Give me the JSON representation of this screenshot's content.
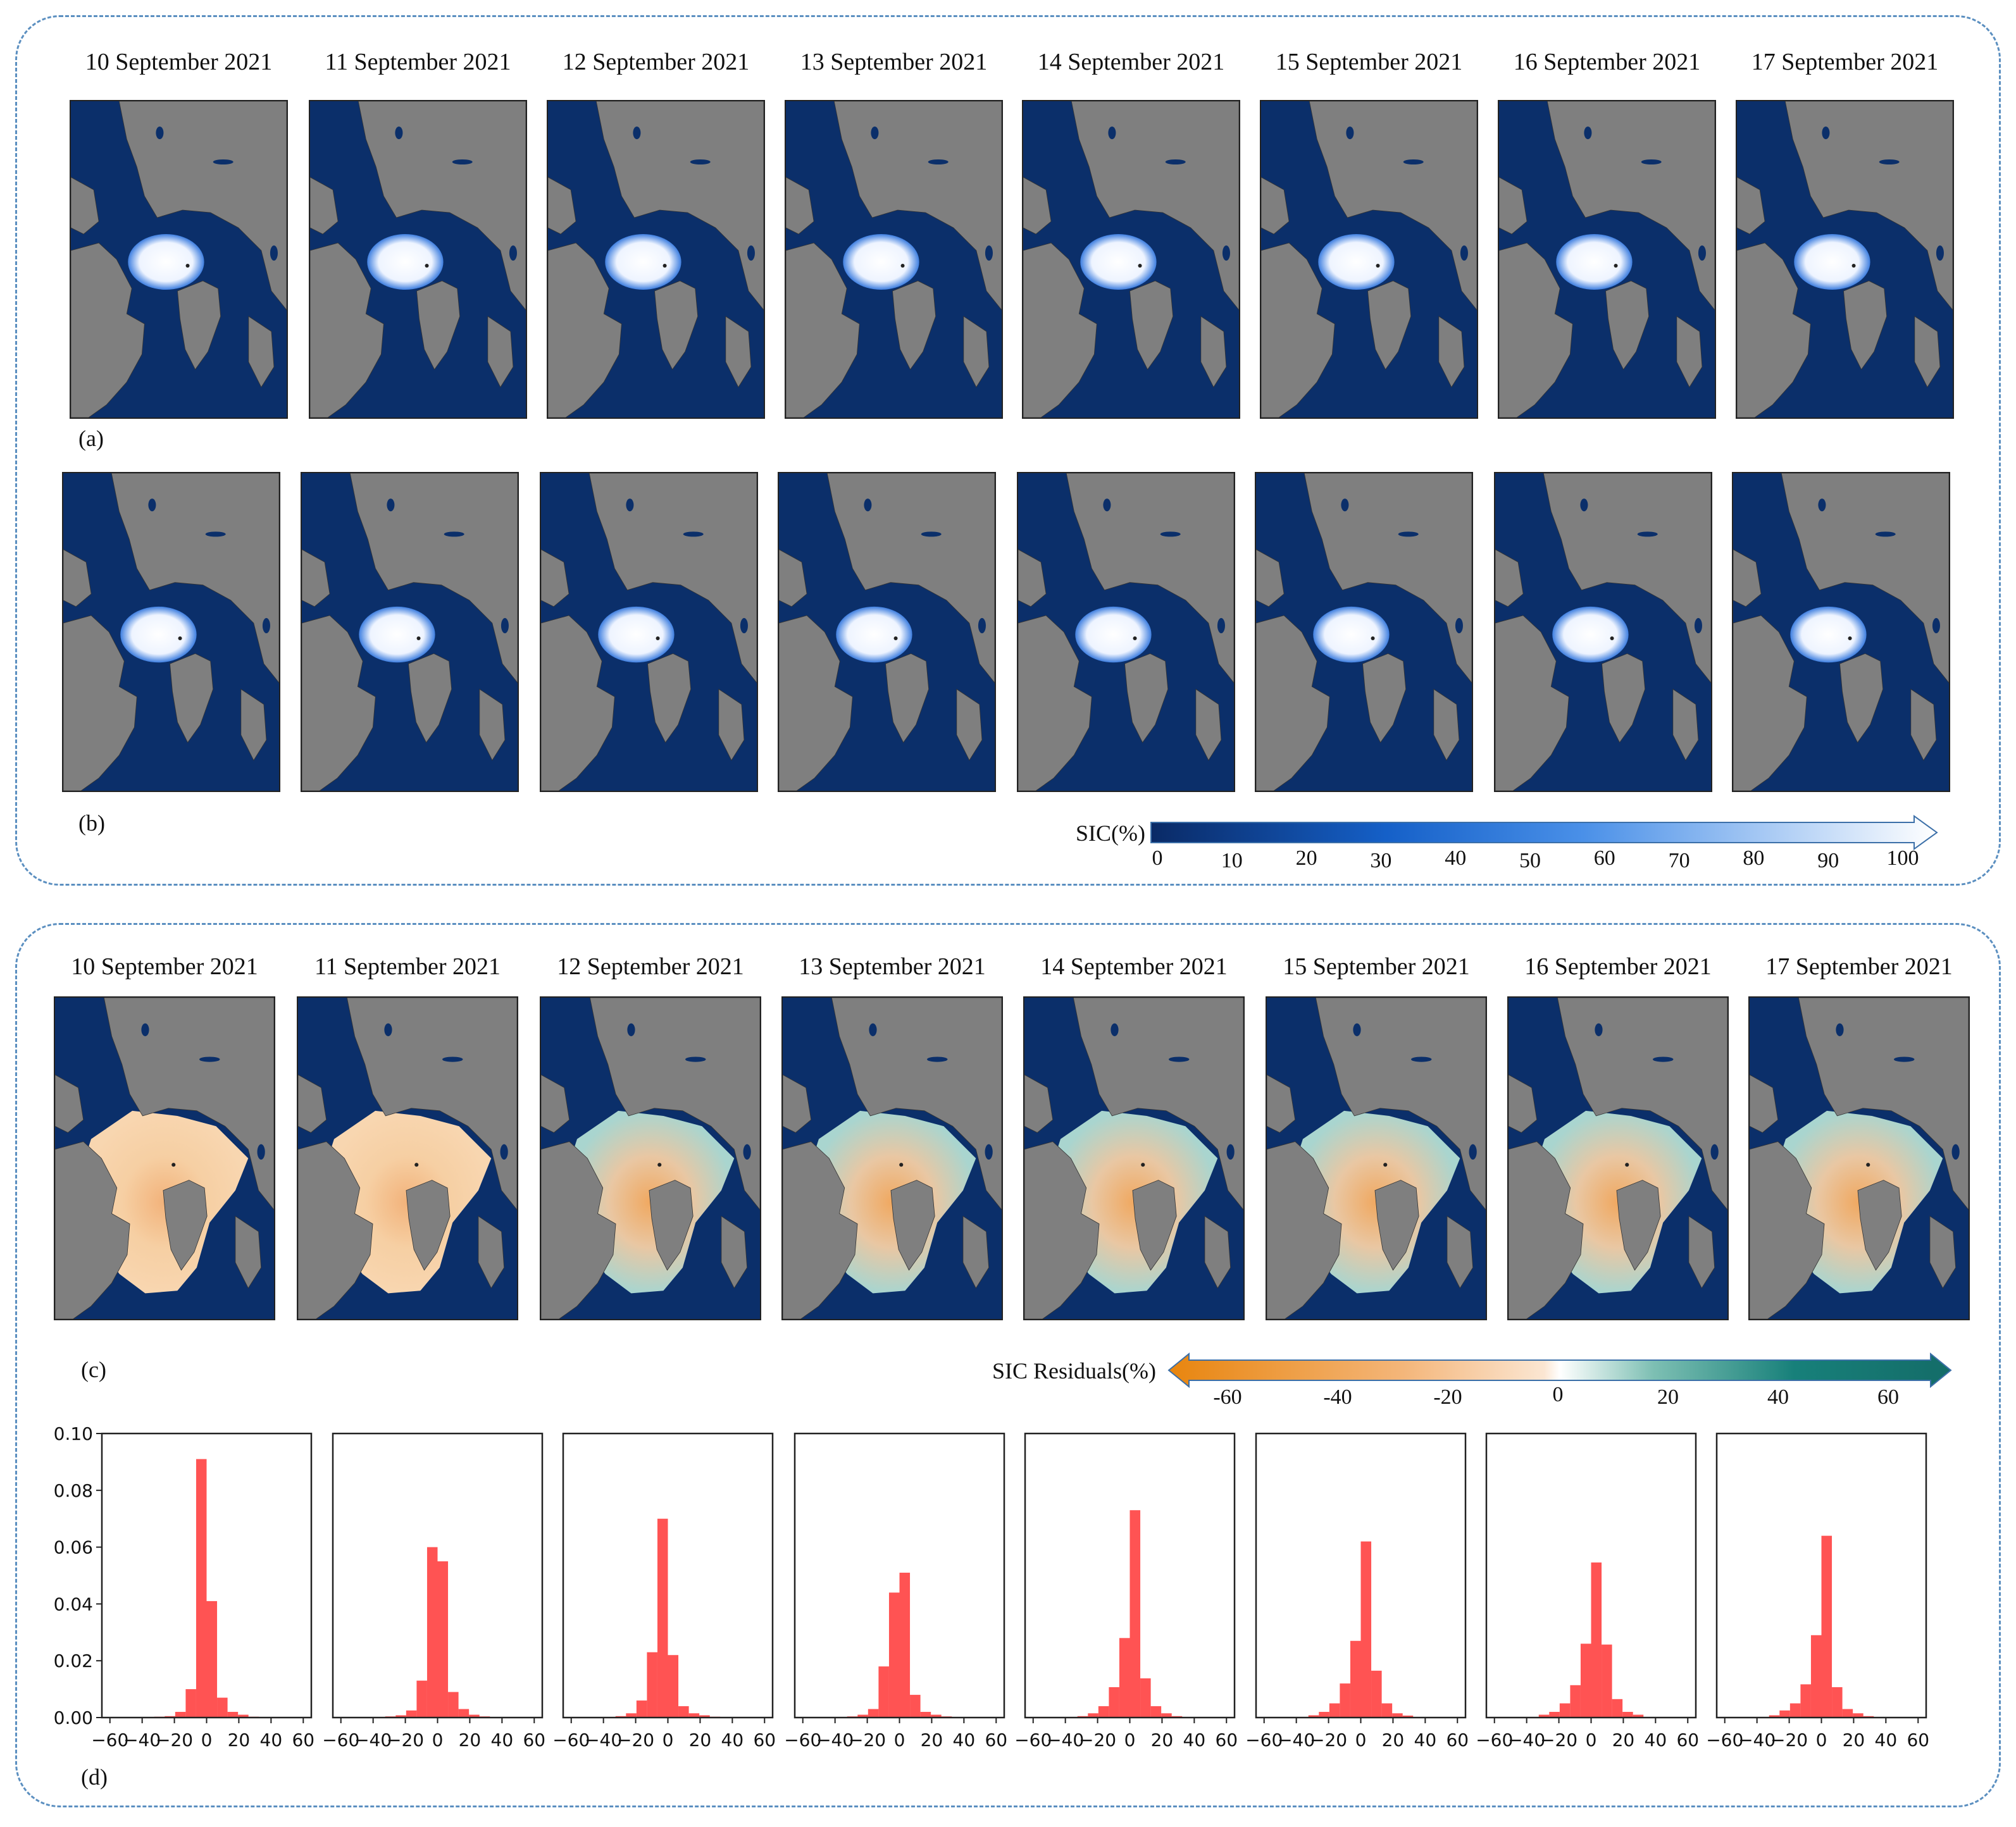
{
  "dates": [
    "10 September 2021",
    "11 September 2021",
    "12 September 2021",
    "13 September 2021",
    "14 September 2021",
    "15 September 2021",
    "16 September 2021",
    "17 September 2021"
  ],
  "panel_labels": {
    "a": "(a)",
    "b": "(b)",
    "c": "(c)",
    "d": "(d)"
  },
  "sic_colorbar": {
    "label": "SIC(%)",
    "ticks": [
      "0",
      "10",
      "20",
      "30",
      "40",
      "50",
      "60",
      "70",
      "80",
      "90",
      "100"
    ],
    "colors": [
      "#0a2a66",
      "#1560c8",
      "#4a90e8",
      "#ffffff"
    ]
  },
  "residual_colorbar": {
    "label": "SIC Residuals(%)",
    "ticks": [
      "-60",
      "-40",
      "-20",
      "0",
      "20",
      "40",
      "60"
    ],
    "colors": [
      "#e8850e",
      "#f7d3ac",
      "#ffffff",
      "#5fb0a3",
      "#15706a"
    ]
  },
  "colors": {
    "ocean": "#0b2f6a",
    "land": "#7f7f7f",
    "hist_bar": "#ff4a4a",
    "frame": "#5b8fc0"
  },
  "chart_data": {
    "type": "bar",
    "title": "SIC residual histograms (d)",
    "xlim": [
      -65,
      65
    ],
    "ylim": [
      0,
      0.1
    ],
    "xticks": [
      "−60",
      "−40",
      "−20",
      "0",
      "20",
      "40",
      "60"
    ],
    "yticks": [
      "0.00",
      "0.02",
      "0.04",
      "0.06",
      "0.08",
      "0.10"
    ],
    "bin_edges": [
      -32.5,
      -26,
      -19.5,
      -13,
      -6.5,
      0,
      6.5,
      13,
      19.5,
      26,
      32.5
    ],
    "series": [
      {
        "name": "10 September 2021",
        "values": [
          0.0003,
          0.0005,
          0.002,
          0.01,
          0.091,
          0.041,
          0.007,
          0.002,
          0.001,
          0.0003
        ]
      },
      {
        "name": "11 September 2021",
        "values": [
          0.0004,
          0.0008,
          0.0025,
          0.013,
          0.06,
          0.055,
          0.009,
          0.003,
          0.001,
          0.0004
        ]
      },
      {
        "name": "12 September 2021",
        "values": [
          0.0005,
          0.0015,
          0.006,
          0.023,
          0.07,
          0.022,
          0.004,
          0.0015,
          0.0008,
          0.0003
        ]
      },
      {
        "name": "13 September 2021",
        "values": [
          0.0004,
          0.001,
          0.003,
          0.018,
          0.044,
          0.051,
          0.008,
          0.002,
          0.001,
          0.0004
        ]
      },
      {
        "name": "14 September 2021",
        "values": [
          0.0005,
          0.0015,
          0.004,
          0.0107,
          0.028,
          0.073,
          0.0138,
          0.004,
          0.0015,
          0.0005
        ]
      },
      {
        "name": "15 September 2021",
        "values": [
          0.0008,
          0.002,
          0.005,
          0.012,
          0.027,
          0.062,
          0.0165,
          0.005,
          0.0015,
          0.0007
        ]
      },
      {
        "name": "16 September 2021",
        "values": [
          0.001,
          0.002,
          0.005,
          0.0114,
          0.026,
          0.0546,
          0.0257,
          0.0065,
          0.002,
          0.001
        ]
      },
      {
        "name": "17 September 2021",
        "values": [
          0.0008,
          0.0025,
          0.005,
          0.0117,
          0.029,
          0.064,
          0.0107,
          0.003,
          0.0015,
          0.0005
        ]
      }
    ]
  }
}
